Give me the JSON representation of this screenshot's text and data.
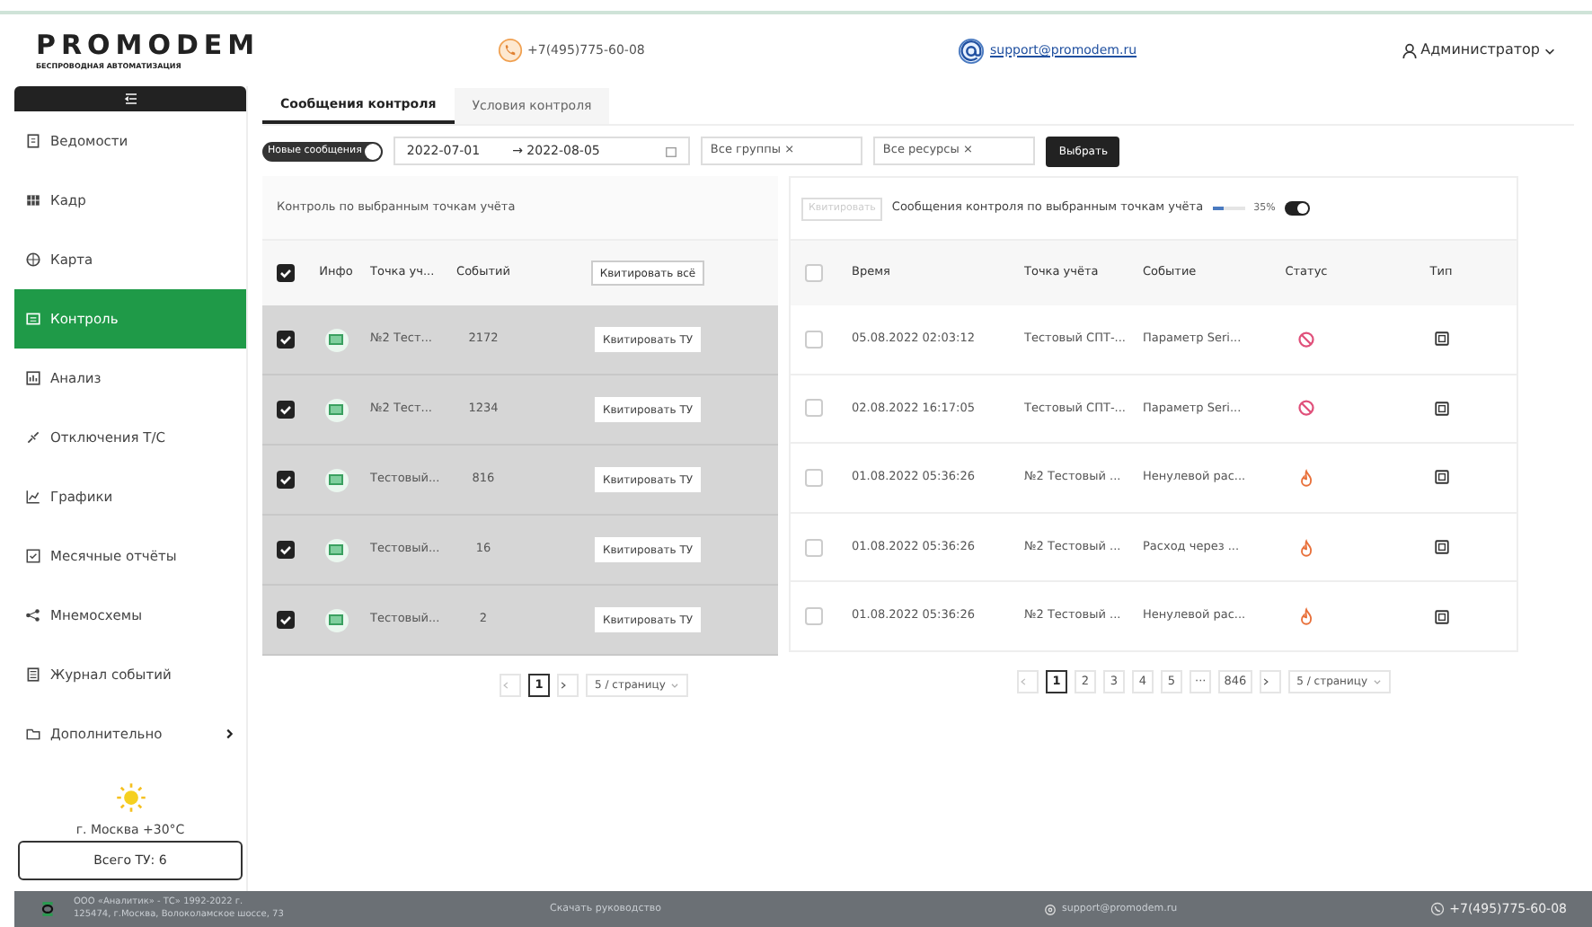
{
  "header": {
    "logo": "PROMODEM",
    "tagline": "БЕСПРОВОДНАЯ АВТОМАТИЗАЦИЯ",
    "phone": "+7(495)775-60-08",
    "email": "support@promodem.ru",
    "user": "Администратор"
  },
  "sidebar": {
    "items": [
      {
        "label": "Ведомости",
        "selected": false,
        "expandable": false
      },
      {
        "label": "Кадр",
        "selected": false,
        "expandable": false
      },
      {
        "label": "Карта",
        "selected": false,
        "expandable": false
      },
      {
        "label": "Контроль",
        "selected": true,
        "expandable": false
      },
      {
        "label": "Анализ",
        "selected": false,
        "expandable": false
      },
      {
        "label": "Отключения Т/С",
        "selected": false,
        "expandable": false
      },
      {
        "label": "Графики",
        "selected": false,
        "expandable": false
      },
      {
        "label": "Месячные отчёты",
        "selected": false,
        "expandable": false
      },
      {
        "label": "Мнемосхемы",
        "selected": false,
        "expandable": false
      },
      {
        "label": "Журнал событий",
        "selected": false,
        "expandable": false
      },
      {
        "label": "Дополнительно",
        "selected": false,
        "expandable": true
      }
    ],
    "weather": "г. Москва +30°C",
    "total_button": "Всего ТУ: 6"
  },
  "tabs": [
    {
      "label": "Сообщения контроля",
      "selected": true
    },
    {
      "label": "Условия контроля",
      "selected": false
    }
  ],
  "filters": {
    "new_messages": {
      "label": "Новые сообщения",
      "on": true
    },
    "date_from": "2022-07-01",
    "date_to": "→ 2022-08-05",
    "groups": "Все группы ×",
    "resources": "Все ресурсы ×",
    "apply": "Выбрать"
  },
  "left_panel": {
    "title": "Контроль по выбранным точкам учёта",
    "columns": [
      "Инфо",
      "Точка уч...",
      "Событий"
    ],
    "ack_all": "Квитировать всё",
    "all_checked": true,
    "rows": [
      {
        "checked": true,
        "point": "№2 Тест...",
        "events": "2172",
        "action": "Квитировать ТУ"
      },
      {
        "checked": true,
        "point": "№2 Тест...",
        "events": "1234",
        "action": "Квитировать ТУ"
      },
      {
        "checked": true,
        "point": "Тестовый...",
        "events": "816",
        "action": "Квитировать ТУ"
      },
      {
        "checked": true,
        "point": "Тестовый...",
        "events": "16",
        "action": "Квитировать ТУ"
      },
      {
        "checked": true,
        "point": "Тестовый...",
        "events": "2",
        "action": "Квитировать ТУ"
      }
    ],
    "pagination": {
      "pages": [
        {
          "label": "1",
          "selected": true
        }
      ],
      "per_page": "5 / страницу"
    }
  },
  "right_panel": {
    "ack_button": "Квитировать",
    "title": "Сообщения контроля по выбранным точкам учёта",
    "slider": {
      "level": 0.35
    },
    "reading": "35%",
    "toggle_on": true,
    "columns": [
      "Время",
      "Точка учёта",
      "Событие",
      "Статус",
      "Тип"
    ],
    "all_checked": false,
    "rows": [
      {
        "checked": false,
        "time": "05.08.2022 02:03:12",
        "point": "Тестовый СПТ-...",
        "event": "Параметр Seri...",
        "kind": "blocked",
        "color": "#e0507a"
      },
      {
        "checked": false,
        "time": "02.08.2022 16:17:05",
        "point": "Тестовый СПТ-...",
        "event": "Параметр Seri...",
        "kind": "blocked",
        "color": "#e0507a"
      },
      {
        "checked": false,
        "time": "01.08.2022 05:36:26",
        "point": "№2 Тестовый ...",
        "event": "Ненулевой рас...",
        "kind": "flame",
        "color": "#e8703a"
      },
      {
        "checked": false,
        "time": "01.08.2022 05:36:26",
        "point": "№2 Тестовый ...",
        "event": "Расход через ...",
        "kind": "flame",
        "color": "#e8703a"
      },
      {
        "checked": false,
        "time": "01.08.2022 05:36:26",
        "point": "№2 Тестовый ...",
        "event": "Ненулевой рас...",
        "kind": "flame",
        "color": "#e8703a"
      }
    ],
    "pagination": {
      "pages": [
        {
          "label": "1",
          "selected": true
        },
        {
          "label": "2",
          "selected": false
        },
        {
          "label": "3",
          "selected": false
        },
        {
          "label": "4",
          "selected": false
        },
        {
          "label": "5",
          "selected": false
        },
        {
          "label": "···",
          "selected": false
        },
        {
          "label": "846",
          "selected": false
        }
      ],
      "per_page": "5 / страницу"
    }
  },
  "footer": {
    "company": "ООО «Аналитик» - ТС» 1992-2022 г.",
    "address": "125474, г.Москва, Волоколамское шоссе, 73",
    "download": "Скачать руководство",
    "email": "support@promodem.ru",
    "phone": "+7(495)775-60-08"
  }
}
